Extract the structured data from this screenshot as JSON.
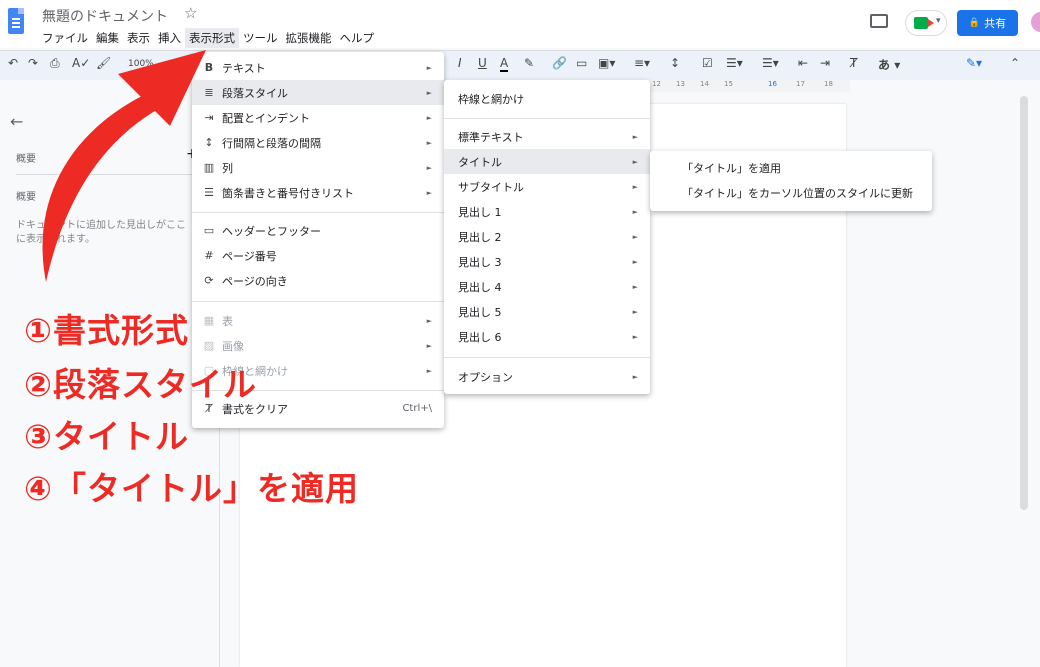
{
  "doc_title": "無題のドキュメント",
  "menubar": [
    "ファイル",
    "編集",
    "表示",
    "挿入",
    "表示形式",
    "ツール",
    "拡張機能",
    "ヘルプ"
  ],
  "active_menu_index": 4,
  "share_label": "共有",
  "toolbar": {
    "zoom": "100%",
    "input_char": "あ"
  },
  "ruler_ticks": [
    "12",
    "13",
    "14",
    "15",
    "16",
    "17",
    "18"
  ],
  "outline": {
    "header": "概要",
    "section": "概要",
    "hint_line1": "ドキュメントに追加した見出しがここ",
    "hint_line2": "に表示されます。",
    "add_symbol": "+"
  },
  "format_menu": {
    "items": [
      {
        "label": "テキスト",
        "icon": "bold-icon",
        "submenu": true
      },
      {
        "label": "段落スタイル",
        "icon": "paragraph-icon",
        "submenu": true,
        "highlighted": true
      },
      {
        "label": "配置とインデント",
        "icon": "indent-icon",
        "submenu": true
      },
      {
        "label": "行間隔と段落の間隔",
        "icon": "line-spacing-icon",
        "submenu": true
      },
      {
        "label": "列",
        "icon": "columns-icon",
        "submenu": true
      },
      {
        "label": "箇条書きと番号付きリスト",
        "icon": "list-icon",
        "submenu": true
      },
      {
        "label": "ヘッダーとフッター",
        "icon": "header-icon",
        "submenu": false
      },
      {
        "label": "ページ番号",
        "icon": "hash-icon",
        "submenu": false
      },
      {
        "label": "ページの向き",
        "icon": "orientation-icon",
        "submenu": false
      },
      {
        "label": "表",
        "icon": "table-icon",
        "submenu": true,
        "disabled": true
      },
      {
        "label": "画像",
        "icon": "image-icon",
        "submenu": true,
        "disabled": true
      },
      {
        "label": "枠線と網かけ",
        "icon": "border-icon",
        "submenu": true,
        "disabled": true
      },
      {
        "label": "書式をクリア",
        "icon": "clear-format-icon",
        "submenu": false,
        "shortcut": "Ctrl+\\"
      }
    ]
  },
  "paragraph_menu": {
    "items": [
      {
        "label": "枠線と網かけ",
        "submenu": false
      },
      {
        "label": "標準テキスト",
        "submenu": true
      },
      {
        "label": "タイトル",
        "submenu": true,
        "highlighted": true
      },
      {
        "label": "サブタイトル",
        "submenu": true
      },
      {
        "label": "見出し 1",
        "submenu": true
      },
      {
        "label": "見出し 2",
        "submenu": true
      },
      {
        "label": "見出し 3",
        "submenu": true
      },
      {
        "label": "見出し 4",
        "submenu": true
      },
      {
        "label": "見出し 5",
        "submenu": true
      },
      {
        "label": "見出し 6",
        "submenu": true
      },
      {
        "label": "オプション",
        "submenu": true
      }
    ]
  },
  "title_menu": {
    "items": [
      {
        "label": "「タイトル」を適用"
      },
      {
        "label": "「タイトル」をカーソル位置のスタイルに更新"
      }
    ]
  },
  "annotations": [
    "①書式形式",
    "②段落スタイル",
    "③タイトル",
    "④「タイトル」を適用"
  ],
  "colors": {
    "annotation": "#ee2a24",
    "share_button": "#1a73e8",
    "menu_highlight": "#e8eaed"
  }
}
